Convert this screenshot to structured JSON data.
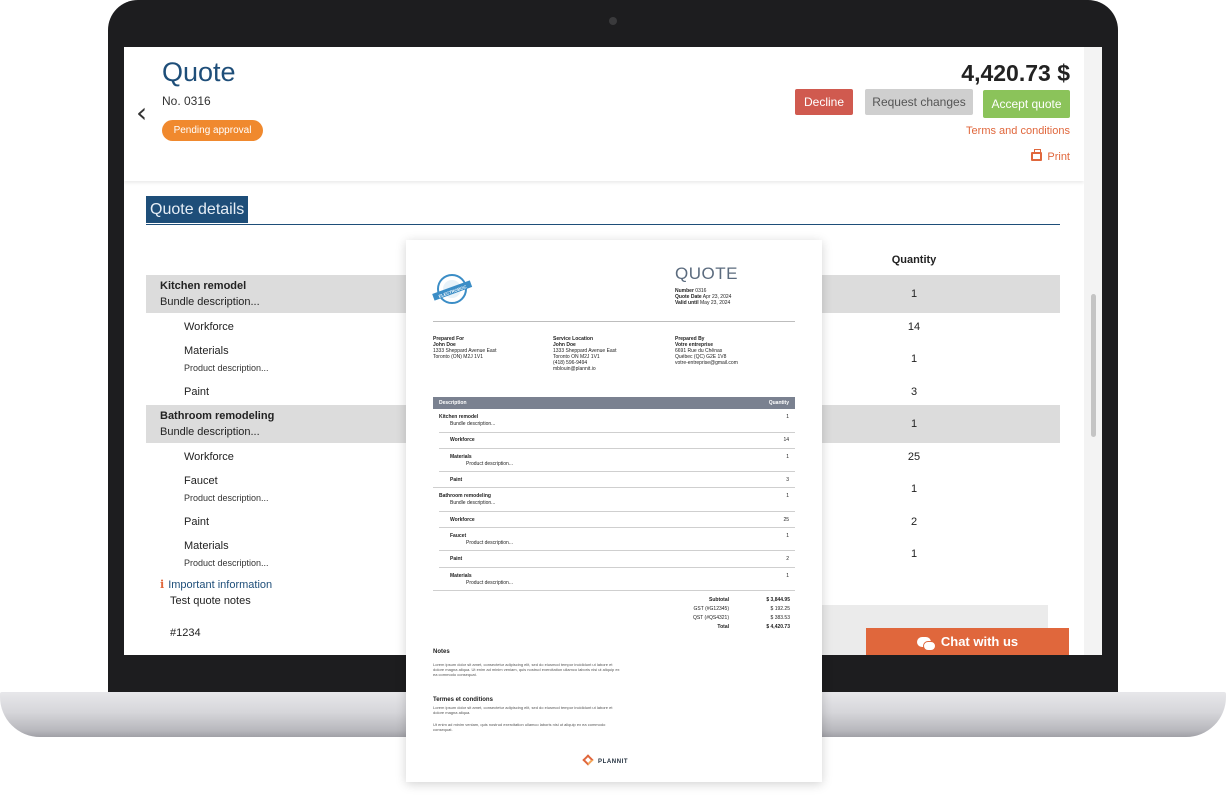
{
  "header": {
    "title": "Quote",
    "number": "No. 0316",
    "status": "Pending approval",
    "amount": "4,420.73 $",
    "back_icon": "‹",
    "buttons": {
      "decline": "Decline",
      "request_changes": "Request changes",
      "accept": "Accept quote"
    },
    "terms_link": "Terms and conditions",
    "print_label": "Print"
  },
  "details": {
    "section_title": "Quote details",
    "quantity_header": "Quantity",
    "rows": [
      {
        "name": "Kitchen remodel",
        "desc": "Bundle description...",
        "qty": "1"
      },
      {
        "name": "Workforce",
        "qty": "14"
      },
      {
        "name": "Materials",
        "desc": "Product description...",
        "qty": "1"
      },
      {
        "name": "Paint",
        "qty": "3"
      },
      {
        "name": "Bathroom remodeling",
        "desc": "Bundle description...",
        "qty": "1"
      },
      {
        "name": "Workforce",
        "qty": "25"
      },
      {
        "name": "Faucet",
        "desc": "Product description...",
        "qty": "1"
      },
      {
        "name": "Paint",
        "qty": "2"
      },
      {
        "name": "Materials",
        "desc": "Product description...",
        "qty": "1"
      }
    ],
    "info_title": "Important information",
    "info_icon": "i",
    "notes": "Test quote notes",
    "reference": "#1234"
  },
  "chat": {
    "label": "Chat with us"
  },
  "document": {
    "title": "QUOTE",
    "logo_text": "ELECTROBOC",
    "meta": {
      "number_label": "Number",
      "number": "0316",
      "date_label": "Quote Date",
      "date": "Apr 23, 2024",
      "valid_label": "Valid until",
      "valid": "May 23, 2024"
    },
    "prepared_for": {
      "heading": "Prepared For",
      "lines": [
        "John Doe",
        "1333 Sheppard Avenue East",
        "Toronto (ON) M2J 1V1"
      ]
    },
    "service_location": {
      "heading": "Service Location",
      "lines": [
        "John Doe",
        "1333 Sheppard Avenue East",
        "Toronto ON M2J 1V1",
        "(418) 596-9494",
        "mblouin@plannit.io"
      ]
    },
    "prepared_by": {
      "heading": "Prepared By",
      "lines": [
        "Votre entreprise",
        "6691 Rue du Chênas",
        "Québec (QC) G2E 1V8",
        "votre-entreprise@gmail.com"
      ]
    },
    "table_headers": {
      "description": "Description",
      "quantity": "Quantity"
    },
    "rows": [
      {
        "name": "Kitchen remodel",
        "desc": "Bundle description...",
        "qty": "1"
      },
      {
        "name": "Workforce",
        "qty": "14"
      },
      {
        "name": "Materials",
        "desc": "Product description...",
        "qty": "1"
      },
      {
        "name": "Paint",
        "qty": "3"
      },
      {
        "name": "Bathroom remodeling",
        "desc": "Bundle description...",
        "qty": "1"
      },
      {
        "name": "Workforce",
        "qty": "25"
      },
      {
        "name": "Faucet",
        "desc": "Product description...",
        "qty": "1"
      },
      {
        "name": "Paint",
        "qty": "2"
      },
      {
        "name": "Materials",
        "desc": "Product description...",
        "qty": "1"
      }
    ],
    "totals": [
      {
        "label": "Subtotal",
        "value": "$ 3,844.95"
      },
      {
        "label": "GST (#G12345)",
        "value": "$ 192.25"
      },
      {
        "label": "QST (#QS4321)",
        "value": "$ 383.53"
      },
      {
        "label": "Total",
        "value": "$ 4,420.73"
      }
    ],
    "notes_heading": "Notes",
    "notes_text": "Lorem ipsum dolor sit amet, consectetur adipiscing elit, sed do eiusmod tempor incididunt ut labore et dolore magna aliqua. Ut enim ad minim veniam, quis nostrud exercitation ullamco laboris nisi ut aliquip ex ea commodo consequat.",
    "terms_heading": "Termes et conditions",
    "terms_text_1": "Lorem ipsum dolor sit amet, consectetur adipiscing elit, sed do eiusmod tempor incididunt ut labore et dolore magna aliqua.",
    "terms_text_2": "Ut enim ad minim veniam, quis nostrud exercitation ullamco laboris nisi ut aliquip ex ea commodo consequat.",
    "brand": "PLANNIT"
  },
  "colors": {
    "primary": "#1e4e79",
    "accent": "#e0673c",
    "status": "#f0892e",
    "decline": "#d05a4f",
    "accept": "#8bc35a"
  }
}
